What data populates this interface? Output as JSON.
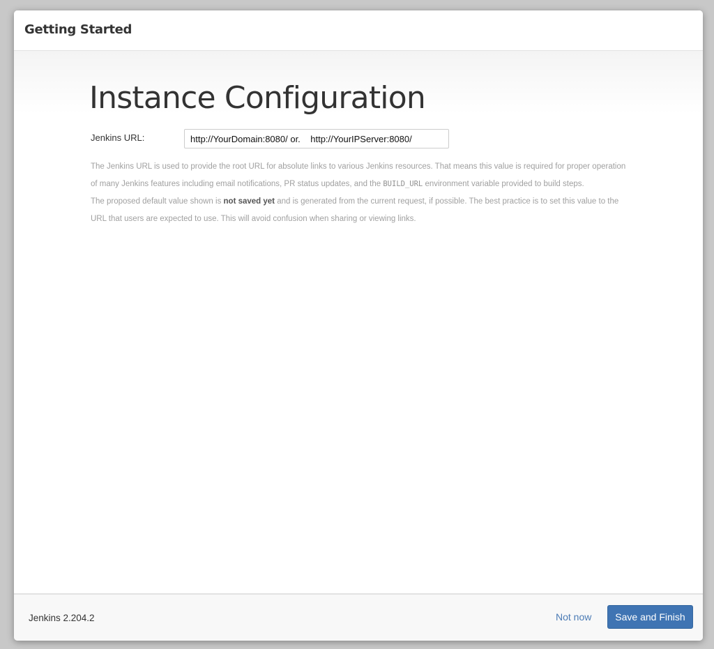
{
  "header": {
    "title": "Getting Started"
  },
  "main": {
    "heading": "Instance Configuration",
    "url_label": "Jenkins URL:",
    "url_value": "http://YourDomain:8080/ or.    http://YourIPServer:8080/",
    "help": {
      "p1_part1": "The Jenkins URL is used to provide the root URL for absolute links to various Jenkins resources. That means this value is required for proper operation of many Jenkins features including email notifications, PR status updates, and the ",
      "p1_code": "BUILD_URL",
      "p1_part2": " environment variable provided to build steps.",
      "p2_part1": "The proposed default value shown is ",
      "p2_strong": "not saved yet",
      "p2_part2": " and is generated from the current request, if possible. The best practice is to set this value to the URL that users are expected to use. This will avoid confusion when sharing or viewing links."
    }
  },
  "footer": {
    "version": "Jenkins 2.204.2",
    "not_now_label": "Not now",
    "save_label": "Save and Finish"
  },
  "colors": {
    "primary_button": "#3f74b3",
    "link": "#4b7bb5",
    "help_text": "#a0a0a0"
  }
}
